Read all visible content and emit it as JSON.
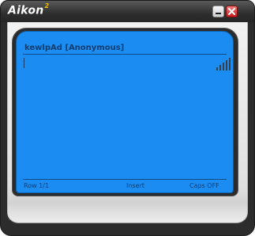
{
  "app": {
    "title": "Aikon",
    "title_superscript": "2"
  },
  "titlebar": {
    "minimize_icon": "minimize-icon",
    "close_icon": "close-icon"
  },
  "message": {
    "from": "kewlpAd [Anonymous]",
    "body": ""
  },
  "status": {
    "signal_icon": "signal-strength-icon",
    "row": "Row 1/1",
    "mode": "Insert",
    "caps": "Caps OFF"
  },
  "colors": {
    "screen": "#1b8cf2",
    "chrome": "#2c2c2c",
    "close_button": "#cc1a1a",
    "logo_superscript": "#f3c000"
  }
}
